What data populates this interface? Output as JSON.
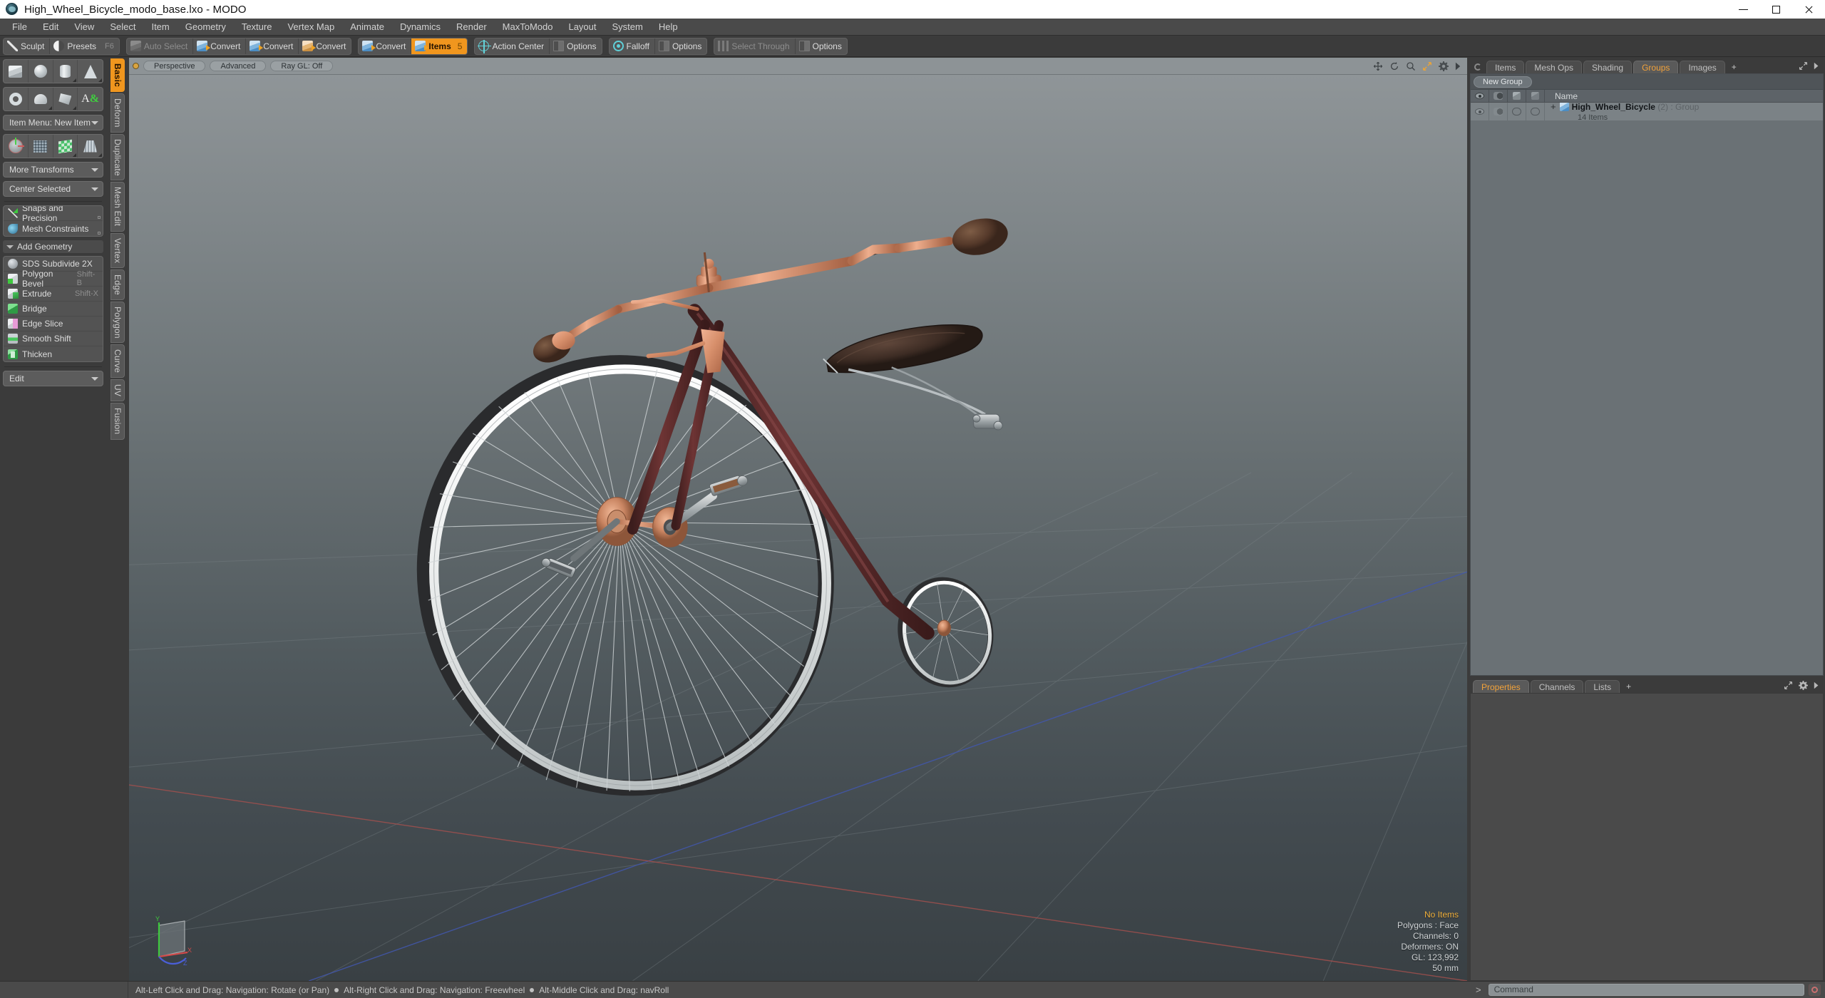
{
  "window": {
    "title": "High_Wheel_Bicycle_modo_base.lxo - MODO",
    "app_icon": "modo-globe-icon",
    "minimize": "minimize-icon",
    "maximize": "maximize-icon",
    "close": "close-icon"
  },
  "menubar": {
    "items": [
      {
        "label": "File"
      },
      {
        "label": "Edit"
      },
      {
        "label": "View"
      },
      {
        "label": "Select"
      },
      {
        "label": "Item"
      },
      {
        "label": "Geometry"
      },
      {
        "label": "Texture"
      },
      {
        "label": "Vertex Map"
      },
      {
        "label": "Animate"
      },
      {
        "label": "Dynamics"
      },
      {
        "label": "Render"
      },
      {
        "label": "MaxToModo"
      },
      {
        "label": "Layout"
      },
      {
        "label": "System"
      },
      {
        "label": "Help"
      }
    ]
  },
  "toolbar": {
    "group1": [
      {
        "label": "Sculpt",
        "icon": "sculpt-icon",
        "shortcut": ""
      },
      {
        "label": "Presets",
        "icon": "presets-sphere-icon",
        "shortcut": "F6"
      }
    ],
    "group2": [
      {
        "label": "Auto Select",
        "icon": "cube-icon",
        "state": "disabled"
      },
      {
        "label": "Convert",
        "icon": "convert-blue-cube-icon",
        "state": "normal"
      },
      {
        "label": "Convert",
        "icon": "convert-blue-cube-icon",
        "state": "normal"
      },
      {
        "label": "Convert",
        "icon": "convert-orange-cube-icon",
        "state": "normal"
      }
    ],
    "group3": [
      {
        "label": "Convert",
        "icon": "convert-blue-cube-icon",
        "state": "normal"
      },
      {
        "label": "Items",
        "icon": "items-cube-icon",
        "state": "active",
        "count": "5"
      }
    ],
    "group4": [
      {
        "label": "Action Center",
        "icon": "action-center-icon",
        "state": "normal"
      },
      {
        "label": "Options",
        "icon": "options-icon",
        "state": "normal"
      }
    ],
    "group5": [
      {
        "label": "Falloff",
        "icon": "falloff-icon",
        "state": "normal"
      },
      {
        "label": "Options",
        "icon": "options-icon",
        "state": "normal"
      }
    ],
    "group6": [
      {
        "label": "Select Through",
        "icon": "select-through-icon",
        "state": "disabled"
      },
      {
        "label": "Options",
        "icon": "options-icon",
        "state": "normal"
      }
    ]
  },
  "left_panel": {
    "vertical_tabs": [
      {
        "label": "Basic",
        "active": true
      },
      {
        "label": "Deform",
        "active": false
      },
      {
        "label": "Duplicate",
        "active": false
      },
      {
        "label": "Mesh Edit",
        "active": false
      },
      {
        "label": "Vertex",
        "active": false
      },
      {
        "label": "Edge",
        "active": false
      },
      {
        "label": "Polygon",
        "active": false
      },
      {
        "label": "Curve",
        "active": false
      },
      {
        "label": "UV",
        "active": false
      },
      {
        "label": "Fusion",
        "active": false
      }
    ],
    "primitives_row1": [
      {
        "name": "cube-primitive"
      },
      {
        "name": "sphere-primitive"
      },
      {
        "name": "cylinder-primitive"
      },
      {
        "name": "cone-primitive"
      }
    ],
    "primitives_row2": [
      {
        "name": "torus-primitive"
      },
      {
        "name": "tube-primitive"
      },
      {
        "name": "polygon-primitive"
      },
      {
        "name": "text-primitive"
      }
    ],
    "item_menu": {
      "label": "Item Menu: New Item"
    },
    "transforms_row": [
      {
        "name": "transform-gizmo-tool"
      },
      {
        "name": "bend-tool"
      },
      {
        "name": "shear-tool"
      },
      {
        "name": "taper-tool"
      }
    ],
    "more_transforms": {
      "label": "More Transforms"
    },
    "center_selected": {
      "label": "Center Selected"
    },
    "snaps": {
      "label": "Snaps and Precision"
    },
    "constraints": {
      "label": "Mesh Constraints"
    },
    "add_geometry_header": {
      "label": "Add Geometry"
    },
    "geometry_tools": [
      {
        "label": "SDS Subdivide 2X",
        "shortcut": "",
        "icon": "sds-subdivide-icon"
      },
      {
        "label": "Polygon Bevel",
        "shortcut": "Shift-B",
        "icon": "polygon-bevel-icon"
      },
      {
        "label": "Extrude",
        "shortcut": "Shift-X",
        "icon": "extrude-icon"
      },
      {
        "label": "Bridge",
        "shortcut": "",
        "icon": "bridge-icon"
      },
      {
        "label": "Edge Slice",
        "shortcut": "",
        "icon": "edge-slice-icon"
      },
      {
        "label": "Smooth Shift",
        "shortcut": "",
        "icon": "smooth-shift-icon"
      },
      {
        "label": "Thicken",
        "shortcut": "",
        "icon": "thicken-icon"
      }
    ],
    "edit_dropdown": {
      "label": "Edit"
    }
  },
  "viewport": {
    "header": {
      "view_mode": "Perspective",
      "shading_mode": "Advanced",
      "ray_gl": "Ray GL: Off",
      "icons": [
        "pan-icon",
        "rotate-icon",
        "zoom-icon",
        "maximize-viewport-icon",
        "gear-icon",
        "more-arrow-icon"
      ]
    },
    "stats": {
      "selection": "No Items",
      "polygons": "Polygons : Face",
      "channels": "Channels: 0",
      "deformers": "Deformers: ON",
      "gl": "GL: 123,992",
      "focal": "50 mm"
    },
    "axis_gizmo": {
      "x": "X",
      "y": "Y",
      "z": "Z"
    },
    "scene": {
      "model": "High_Wheel_Bicycle penny-farthing",
      "colors": {
        "bg_top": "#8f9598",
        "bg_bottom": "#394044",
        "copper": "#d98f6e",
        "copper_dark": "#a45f42",
        "frame_maroon": "#5c2b2b",
        "leather": "#4c352c",
        "rim_chrome": "#e8eaea",
        "tire_dark": "#2e2e30",
        "grid_line": "#7d868a",
        "axis_x": "#b05a5a",
        "axis_z": "#4a5fb8"
      }
    }
  },
  "right_panel": {
    "tabs": [
      {
        "label": "Items",
        "active": false
      },
      {
        "label": "Mesh Ops",
        "active": false
      },
      {
        "label": "Shading",
        "active": false
      },
      {
        "label": "Groups",
        "active": true
      },
      {
        "label": "Images",
        "active": false
      },
      {
        "label": "+",
        "active": false
      }
    ],
    "new_group_button": "New Group",
    "columns": [
      {
        "name": "visibility-column",
        "icon": "eye-icon"
      },
      {
        "name": "shading-column",
        "icon": "shade-icon"
      },
      {
        "name": "render-column",
        "icon": "cube-icon"
      },
      {
        "name": "select-column",
        "icon": "cube-outline-icon"
      },
      {
        "name": "name-column",
        "label": "Name"
      }
    ],
    "rows": [
      {
        "expander": "+",
        "icon": "group-cube-icon",
        "name": "High_Wheel_Bicycle",
        "count": "(2)",
        "type": ": Group",
        "sub": "14 Items"
      }
    ]
  },
  "properties_panel": {
    "tabs": [
      {
        "label": "Properties",
        "active": true
      },
      {
        "label": "Channels",
        "active": false
      },
      {
        "label": "Lists",
        "active": false
      },
      {
        "label": "+",
        "active": false
      }
    ],
    "icons": [
      "maximize-panel-icon",
      "gear-icon",
      "more-arrow-icon"
    ]
  },
  "statusbar": {
    "hints": [
      "Alt-Left Click and Drag: Navigation: Rotate (or Pan)",
      "Alt-Right Click and Drag: Navigation: Freewheel",
      "Alt-Middle Click and Drag: navRoll"
    ],
    "command_prompt": ">",
    "command_placeholder": "Command",
    "record_button": "record-macro-icon"
  },
  "accent": {
    "orange": "#f0961e",
    "panel_bg": "#3b3b3b",
    "tool_bg": "#545454",
    "list_bg": "#7b8286"
  }
}
